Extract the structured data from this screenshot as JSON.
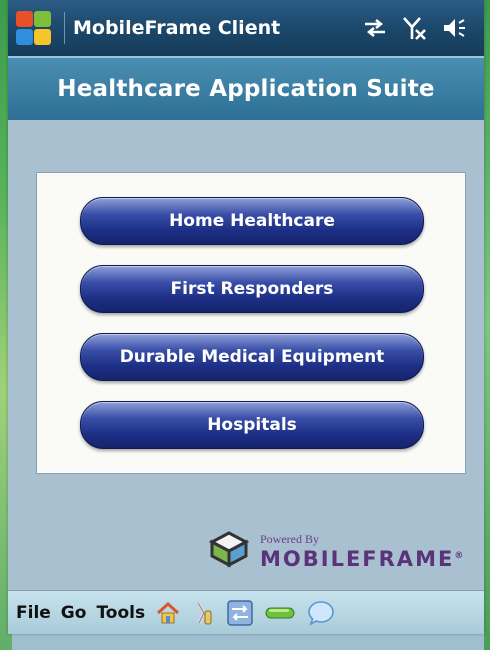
{
  "window": {
    "title": "MobileFrame Client"
  },
  "header": {
    "title": "Healthcare Application Suite"
  },
  "buttons": [
    {
      "label": "Home Healthcare"
    },
    {
      "label": "First Responders"
    },
    {
      "label": "Durable Medical Equipment"
    },
    {
      "label": "Hospitals"
    }
  ],
  "branding": {
    "powered_by": "Powered By",
    "name": "MOBILEFRAME",
    "mark": "®"
  },
  "menubar": {
    "items": [
      "File",
      "Go",
      "Tools"
    ]
  },
  "tray_icons": [
    "sync-arrows-icon",
    "no-signal-icon",
    "speaker-icon"
  ],
  "toolbar_icons": [
    "home-icon",
    "tools-icon",
    "transfer-icon",
    "status-pill-icon",
    "chat-bubble-icon"
  ],
  "colors": {
    "title_bar": "#1a4668",
    "header": "#2d6f95",
    "button": "#1d2f86",
    "background": "#a9c0d0"
  }
}
